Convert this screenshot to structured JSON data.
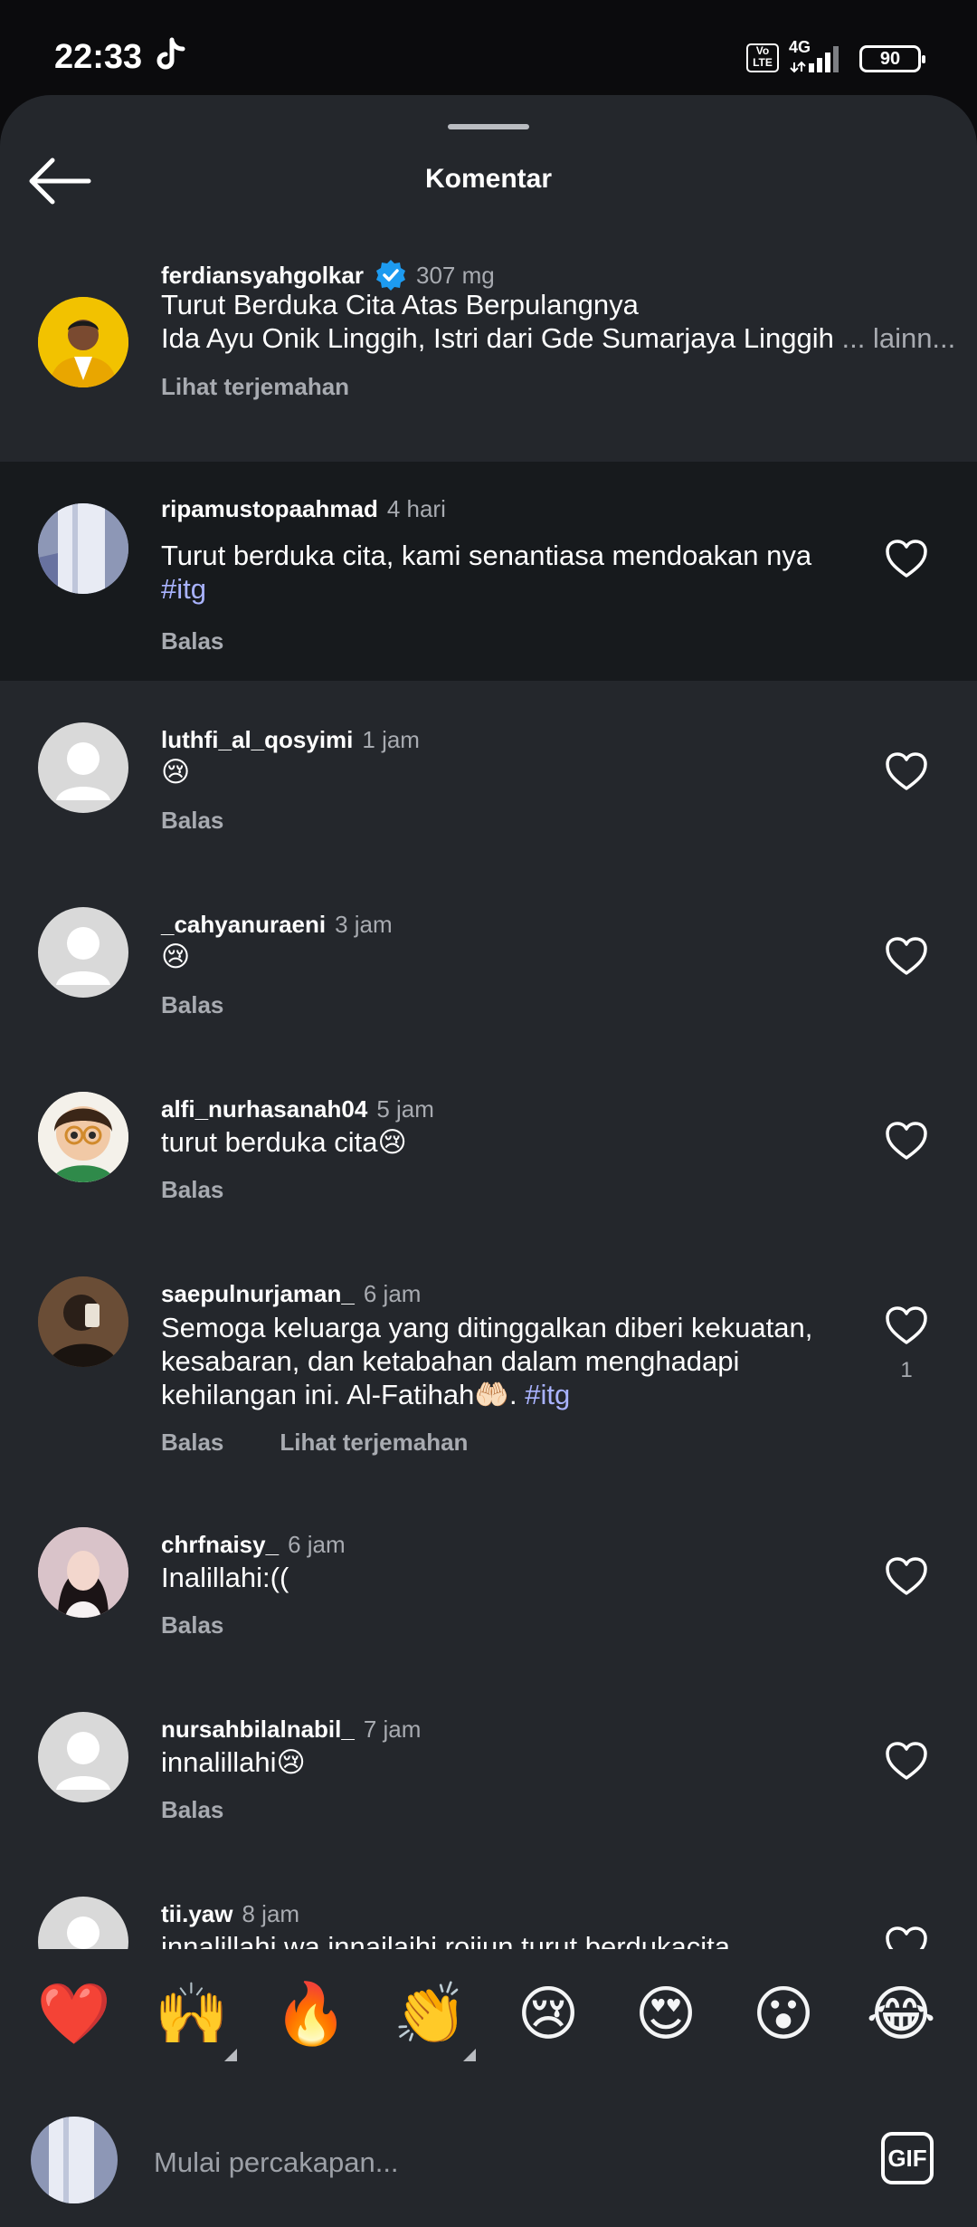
{
  "status_bar": {
    "time": "22:33",
    "volte": "Vo\nLTE",
    "network": "4G",
    "battery": "90"
  },
  "header": {
    "title": "Komentar"
  },
  "caption": {
    "username": "ferdiansyahgolkar",
    "time": "307 mg",
    "line1": "Turut Berduka Cita Atas Berpulangnya",
    "line2": "Ida Ayu Onik Linggih, Istri dari Gde Sumarjaya Linggih",
    "more": "... lainn...",
    "translate": "Lihat terjemahan"
  },
  "comments": [
    {
      "username": "ripamustopaahmad",
      "time": "4 hari",
      "text": "Turut berduka cita, kami senantiasa mendoakan nya",
      "hashtag": "#itg",
      "reply": "Balas"
    },
    {
      "username": "luthfi_al_qosyimi",
      "time": "1 jam",
      "text": "😢",
      "reply": "Balas"
    },
    {
      "username": "_cahyanuraeni",
      "time": "3 jam",
      "text": "😢",
      "reply": "Balas"
    },
    {
      "username": "alfi_nurhasanah04",
      "time": "5 jam",
      "text": "turut berduka cita😢",
      "reply": "Balas"
    },
    {
      "username": "saepulnurjaman_",
      "time": "6 jam",
      "text_line1": "Semoga keluarga yang ditinggalkan diberi kekuatan,",
      "text_line2": "kesabaran, dan ketabahan dalam menghadapi",
      "text_line3": "kehilangan ini. Al-Fatihah🤲🏻.",
      "hashtag": "#itg",
      "reply": "Balas",
      "translate": "Lihat terjemahan",
      "likes": "1"
    },
    {
      "username": "chrfnaisy_",
      "time": "6 jam",
      "text": "Inalillahi:((",
      "reply": "Balas"
    },
    {
      "username": "nursahbilalnabil_",
      "time": "7 jam",
      "text": "innalillahi😢",
      "reply": "Balas"
    },
    {
      "username": "tii.yaw",
      "time": "8 jam",
      "text": "innalillahi wa innailaihi rojiun turut berdukacita"
    }
  ],
  "reactions": [
    "❤️",
    "🙌",
    "🔥",
    "👏",
    "😢",
    "😍",
    "😮",
    "😂"
  ],
  "composer": {
    "placeholder": "Mulai percakapan...",
    "gif_label": "GIF"
  },
  "colors": {
    "sheet_bg": "#24272c",
    "highlight_bg": "#171a1d",
    "secondary_text": "#a8abb1",
    "hashtag": "#a9b3ff",
    "verified": "#1d9bf0"
  },
  "icons": {
    "back": "arrow-left-icon",
    "heart": "heart-outline-icon",
    "verified": "verified-badge-icon",
    "app": "tiktok-icon",
    "gif": "gif-icon"
  }
}
